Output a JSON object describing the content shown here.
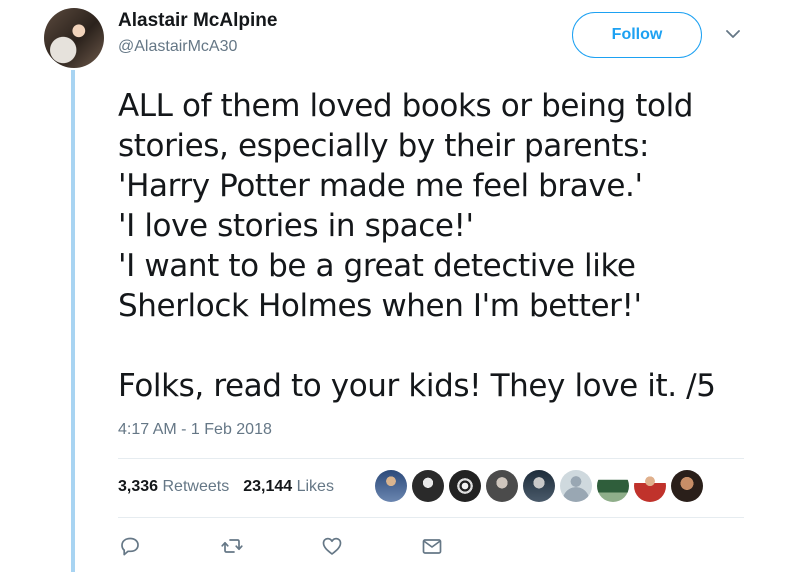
{
  "author": {
    "name": "Alastair McAlpine",
    "handle": "@AlastairMcA30"
  },
  "follow_label": "Follow",
  "tweet_text": "ALL of them loved books or being told\nstories, especially by their parents:\n'Harry Potter made me feel brave.'\n'I love stories in space!'\n'I want to be a great detective like\nSherlock Holmes when I'm better!'\n\nFolks, read to your kids! They love it. /5",
  "timestamp": "4:17 AM - 1 Feb 2018",
  "stats": {
    "retweets_count": "3,336",
    "retweets_label": "Retweets",
    "likes_count": "23,144",
    "likes_label": "Likes"
  },
  "colors": {
    "accent": "#1da1f2",
    "thread_line": "#a8d4f2",
    "secondary_text": "#657786"
  },
  "icons": {
    "reply": "speech-bubble",
    "retweet": "two-arrows-loop",
    "like": "heart-outline",
    "message": "envelope",
    "menu": "chevron-down"
  }
}
